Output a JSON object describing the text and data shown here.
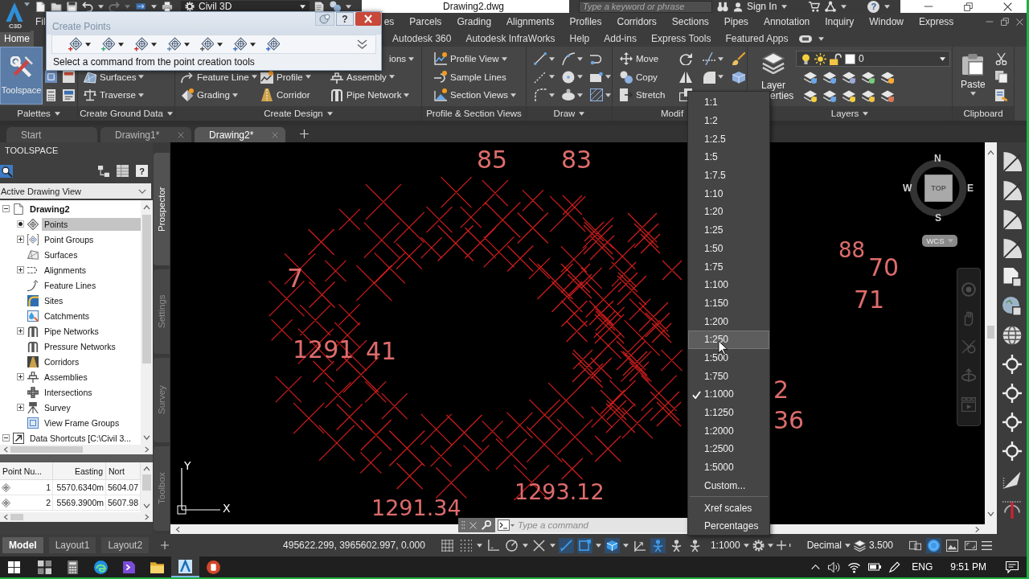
{
  "app_button": {
    "label": "C3D"
  },
  "title_bar": {
    "workspace": "Civil 3D",
    "title": "Drawing2.dwg",
    "search": {
      "placeholder": "Type a keyword or phrase"
    },
    "sign_in": "Sign In",
    "help": "?"
  },
  "menu_bar": [
    "Fil",
    "es",
    "Parcels",
    "Grading",
    "Alignments",
    "Profiles",
    "Corridors",
    "Sections",
    "Pipes",
    "Annotation",
    "Inquiry",
    "Window",
    "Express"
  ],
  "ribbon_tabs": [
    {
      "label": "Home",
      "selected": true
    },
    {
      "label": "Autodesk 360",
      "selected": false
    },
    {
      "label": "Autodesk InfraWorks",
      "selected": false
    },
    {
      "label": "Help",
      "selected": false
    },
    {
      "label": "Add-ins",
      "selected": false
    },
    {
      "label": "Express Tools",
      "selected": false
    },
    {
      "label": "Featured Apps",
      "selected": false
    }
  ],
  "ribbon": {
    "palettes": {
      "title": "Palettes",
      "menu": true,
      "toolspace": {
        "label": "Toolspace",
        "on": true
      }
    },
    "create_ground_data": {
      "title": "Create Ground Data",
      "menu": true,
      "tools": [
        {
          "label": "Surfaces",
          "menu": true
        },
        {
          "label": "Traverse",
          "menu": true
        }
      ]
    },
    "create_design": {
      "title": "Create Design",
      "menu": true,
      "tools": [
        {
          "label": "ions",
          "menu": true
        },
        {
          "label": "Feature Line",
          "menu": true
        },
        {
          "label": "Profile",
          "menu": true
        },
        {
          "label": "Assembly",
          "menu": true
        },
        {
          "label": "Grading",
          "menu": true
        },
        {
          "label": "Corridor",
          "menu": false
        },
        {
          "label": "Pipe Network",
          "menu": true
        }
      ]
    },
    "profile_section_views": {
      "title": "Profile & Section Views",
      "menu": false,
      "tools": [
        {
          "label": "Profile View",
          "menu": true
        },
        {
          "label": "Sample Lines",
          "menu": false
        },
        {
          "label": "Section Views",
          "menu": true
        }
      ]
    },
    "draw": {
      "title": "Draw",
      "menu": true
    },
    "modify": {
      "title": "Modif",
      "menu": false,
      "tools": [
        {
          "label": "Move",
          "menu": false
        },
        {
          "label": "Copy",
          "menu": false
        },
        {
          "label": "Stretch",
          "menu": false
        }
      ]
    },
    "layers": {
      "title": "Layers",
      "menu": true,
      "layer_properties": [
        "Layer",
        "erties"
      ],
      "current_layer": "0"
    },
    "clipboard": {
      "title": "Clipboard",
      "menu": false,
      "paste": {
        "label": "Paste",
        "menu": true
      }
    }
  },
  "file_tabs": [
    {
      "label": "Start",
      "selected": false,
      "closable": false
    },
    {
      "label": "Drawing1*",
      "selected": false,
      "closable": true
    },
    {
      "label": "Drawing2*",
      "selected": true,
      "closable": true
    }
  ],
  "create_points_dialog": {
    "title": "Create Points",
    "help": "?",
    "status": "Select a command from the point creation tools"
  },
  "toolspace": {
    "title": "TOOLSPACE",
    "help": "?",
    "view": "Active Drawing View",
    "tree": [
      {
        "label": "Drawing2",
        "kind": "expanded",
        "selected": false,
        "children": [
          {
            "label": "Points",
            "kind": "bullet",
            "selected": true
          },
          {
            "label": "Point Groups",
            "kind": "collapsed",
            "selected": false
          },
          {
            "label": "Surfaces",
            "kind": "leaf",
            "selected": false
          },
          {
            "label": "Alignments",
            "kind": "collapsed",
            "selected": false
          },
          {
            "label": "Feature Lines",
            "kind": "leaf",
            "selected": false
          },
          {
            "label": "Sites",
            "kind": "leaf",
            "selected": false
          },
          {
            "label": "Catchments",
            "kind": "leaf",
            "selected": false
          },
          {
            "label": "Pipe Networks",
            "kind": "collapsed",
            "selected": false
          },
          {
            "label": "Pressure Networks",
            "kind": "leaf",
            "selected": false
          },
          {
            "label": "Corridors",
            "kind": "leaf",
            "selected": false
          },
          {
            "label": "Assemblies",
            "kind": "collapsed",
            "selected": false
          },
          {
            "label": "Intersections",
            "kind": "leaf",
            "selected": false
          },
          {
            "label": "Survey",
            "kind": "collapsed",
            "selected": false
          },
          {
            "label": "View Frame Groups",
            "kind": "leaf",
            "selected": false
          }
        ]
      },
      {
        "label": "Data Shortcuts [C:\\Civil 3...",
        "kind": "expanded",
        "selected": false
      }
    ],
    "table": {
      "columns": [
        "Point Nu...",
        "Easting",
        "Nort"
      ],
      "rows": [
        [
          "1",
          "5570.6340m",
          "5604.07"
        ],
        [
          "2",
          "5569.3900m",
          "5607.98"
        ]
      ]
    },
    "side_tabs": [
      {
        "label": "Prospector",
        "selected": true
      },
      {
        "label": "Settings",
        "selected": false
      },
      {
        "label": "Survey",
        "selected": false
      },
      {
        "label": "Toolbox",
        "selected": false
      }
    ]
  },
  "drawing": {
    "point_labels": [
      "85",
      "83",
      "7",
      "1291",
      "41",
      "1293.12",
      "1291.34",
      "88",
      "70",
      "71",
      "36",
      "2"
    ],
    "viewcube": {
      "north": "N",
      "east": "E",
      "south": "S",
      "west": "W",
      "face": "TOP",
      "coordinate_system": "WCS"
    },
    "ucs": {
      "x": "X",
      "y": "Y"
    }
  },
  "command_line": {
    "placeholder": "Type a command"
  },
  "scale_menu": {
    "items": [
      {
        "label": "1:1",
        "checked": false,
        "highlighted": false
      },
      {
        "label": "1:2",
        "checked": false,
        "highlighted": false
      },
      {
        "label": "1:2.5",
        "checked": false,
        "highlighted": false
      },
      {
        "label": "1:5",
        "checked": false,
        "highlighted": false
      },
      {
        "label": "1:7.5",
        "checked": false,
        "highlighted": false
      },
      {
        "label": "1:10",
        "checked": false,
        "highlighted": false
      },
      {
        "label": "1:20",
        "checked": false,
        "highlighted": false
      },
      {
        "label": "1:25",
        "checked": false,
        "highlighted": false
      },
      {
        "label": "1:50",
        "checked": false,
        "highlighted": false
      },
      {
        "label": "1:75",
        "checked": false,
        "highlighted": false
      },
      {
        "label": "1:100",
        "checked": false,
        "highlighted": false
      },
      {
        "label": "1:150",
        "checked": false,
        "highlighted": false
      },
      {
        "label": "1:200",
        "checked": false,
        "highlighted": false
      },
      {
        "label": "1:250",
        "checked": false,
        "highlighted": true
      },
      {
        "label": "1:500",
        "checked": false,
        "highlighted": false
      },
      {
        "label": "1:750",
        "checked": false,
        "highlighted": false
      },
      {
        "label": "1:1000",
        "checked": true,
        "highlighted": false
      },
      {
        "label": "1:1250",
        "checked": false,
        "highlighted": false
      },
      {
        "label": "1:2000",
        "checked": false,
        "highlighted": false
      },
      {
        "label": "1:2500",
        "checked": false,
        "highlighted": false
      },
      {
        "label": "1:5000",
        "checked": false,
        "highlighted": false
      },
      {
        "label": "Custom...",
        "checked": false,
        "highlighted": false
      }
    ],
    "extra": [
      "Xref scales",
      "Percentages"
    ]
  },
  "status_bar": {
    "layout_tabs": [
      {
        "label": "Model",
        "selected": true
      },
      {
        "label": "Layout1",
        "selected": false
      },
      {
        "label": "Layout2",
        "selected": false
      }
    ],
    "coordinates": "495622.299, 3965602.997, 0.000",
    "toggles": [
      {
        "on": false
      },
      {
        "on": false
      },
      {
        "on": false
      },
      {
        "on": false
      },
      {
        "on": false
      },
      {
        "on": true
      },
      {
        "on": true
      },
      {
        "on": true
      },
      {
        "on": false
      },
      {
        "on": true
      },
      {
        "on": false
      },
      {
        "on": false
      },
      {
        "on": false
      },
      {
        "on": true
      },
      {
        "on": false
      },
      {
        "on": false
      }
    ],
    "annotation_scale": "1:1000",
    "units": "Decimal",
    "readout": "3.500"
  },
  "taskbar": {
    "apps": [
      {
        "selected": false
      },
      {
        "selected": false
      },
      {
        "selected": false
      },
      {
        "selected": false
      },
      {
        "selected": false
      },
      {
        "selected": true
      },
      {
        "selected": false
      }
    ],
    "language": "ENG",
    "time": "9:51 PM"
  }
}
